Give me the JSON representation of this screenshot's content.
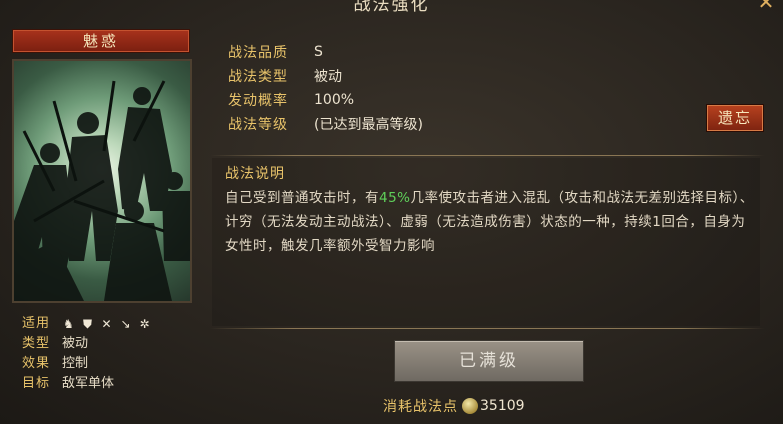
{
  "header": {
    "title": "战法强化",
    "close_label": "✕"
  },
  "card": {
    "name": "魅惑"
  },
  "meta": {
    "applicable_label": "适用",
    "applicable_icons": [
      "cavalry-icon",
      "shield-icon",
      "bow-icon",
      "spear-icon",
      "wheel-icon"
    ],
    "type_label": "类型",
    "type_value": "被动",
    "effect_label": "效果",
    "effect_value": "控制",
    "target_label": "目标",
    "target_value": "敌军单体"
  },
  "info": {
    "quality_label": "战法品质",
    "quality_value": "S",
    "type_label": "战法类型",
    "type_value": "被动",
    "chance_label": "发动概率",
    "chance_value": "100%",
    "level_label": "战法等级",
    "level_value": "(已达到最高等级)"
  },
  "forget_button": "遗忘",
  "description": {
    "title": "战法说明",
    "text_before": "自己受到普通攻击时，有",
    "highlight": "45%",
    "text_after": "几率使攻击者进入混乱（攻击和战法无差别选择目标）、计穷（无法发动主动战法）、虚弱（无法造成伤害）状态的一种，持续1回合，自身为女性时，触发几率额外受智力影响",
    "highlight_color": "#5fcf5a"
  },
  "maxed_button": "已满级",
  "cost": {
    "label": "消耗战法点",
    "value": "35109"
  }
}
